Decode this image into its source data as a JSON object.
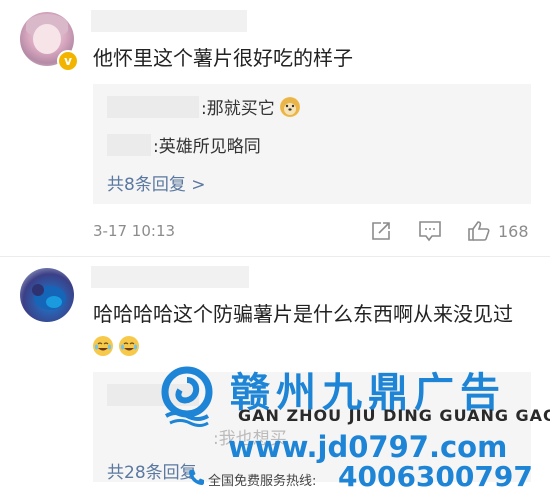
{
  "comments": [
    {
      "text": "他怀里这个薯片很好吃的样子",
      "replies": [
        {
          "text": ":那就买它"
        },
        {
          "text": ":英雄所见略同"
        }
      ],
      "more_replies": "共8条回复 >",
      "timestamp": "3-17 10:13",
      "like_count": "168"
    },
    {
      "text": "哈哈哈哈这个防骗薯片是什么东西啊从来没见过",
      "replies": [
        {
          "text": ":我也想买"
        }
      ],
      "more_replies": "共28条回复"
    }
  ],
  "watermark": {
    "title": "赣州九鼎广告",
    "subtitle": "GAN ZHOU JIU DING GUANG GAO",
    "url": "www.jd0797.com",
    "hotline_label": "全国免费服务热线:",
    "phone": "4006300797"
  },
  "colors": {
    "link": "#5a78a0",
    "brand": "#1d84d6",
    "muted": "#8c8c8c",
    "reply_bg": "#f5f5f5"
  }
}
